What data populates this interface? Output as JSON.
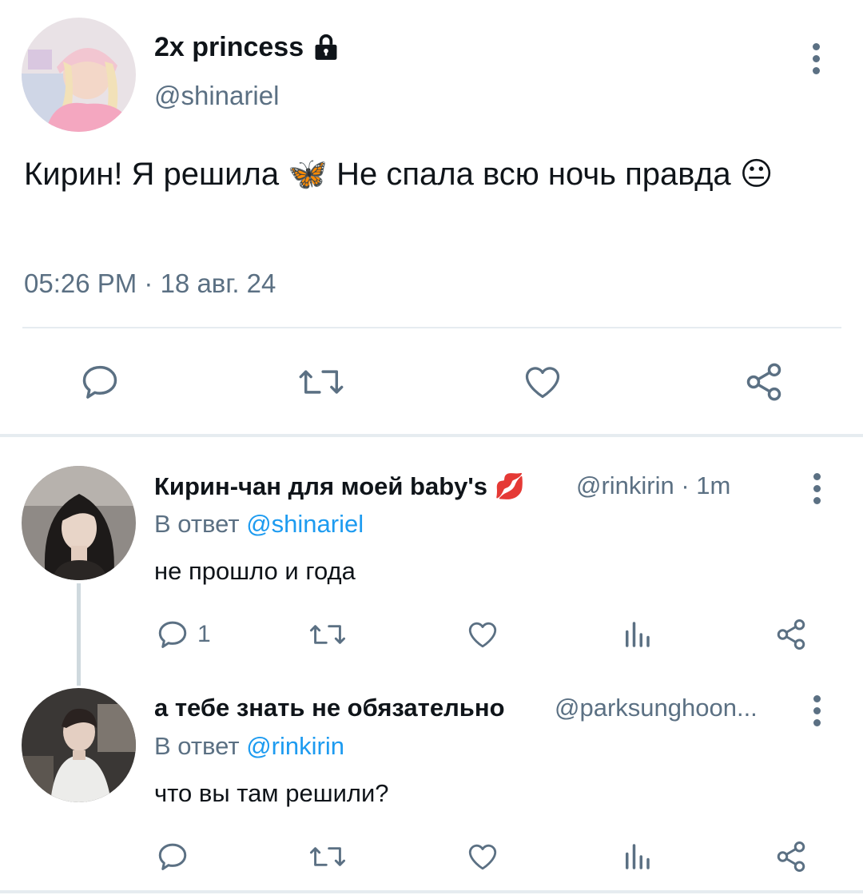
{
  "main_tweet": {
    "display_name": "2x princess",
    "handle": "@shinariel",
    "text": "Кирин! Я решила 🦋 Не спала всю ночь правда 😐",
    "timestamp": "05:26 PM · 18 авг. 24",
    "icons": [
      "lock-icon",
      "more-options-icon",
      "reply-icon",
      "retweet-icon",
      "like-icon",
      "share-icon"
    ]
  },
  "replies": [
    {
      "display_name": "Кирин-чан для моей baby's 💋",
      "meta": "@rinkirin · 1m",
      "reply_prefix": "В ответ",
      "reply_to": "@shinariel",
      "text": "не прошло и года",
      "reply_count": "1"
    },
    {
      "display_name": "а тебе знать не обязательно",
      "meta": "@parksunghoon...",
      "reply_prefix": "В ответ",
      "reply_to": "@rinkirin",
      "text": "что вы там решили?",
      "reply_count": ""
    }
  ],
  "colors": {
    "text": "#0f1419",
    "muted": "#5b7083",
    "link": "#1d9bf0",
    "divider": "#e6ecf0"
  }
}
